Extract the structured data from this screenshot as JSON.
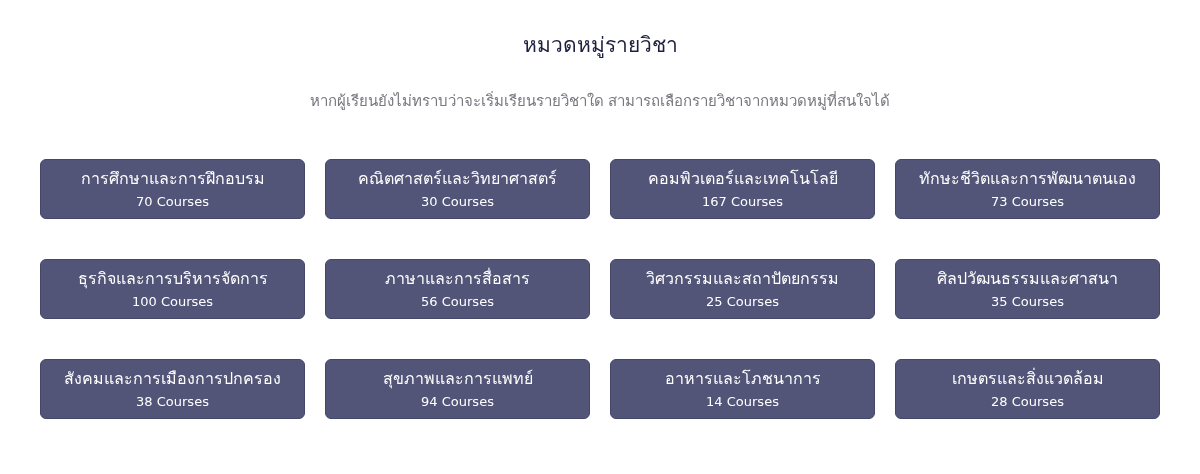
{
  "heading": "หมวดหมู่รายวิชา",
  "subtitle": "หากผู้เรียนยังไม่ทราบว่าจะเริ่มเรียนรายวิชาใด สามารถเลือกรายวิชาจากหมวดหมู่ที่สนใจได้",
  "categories": [
    {
      "name": "การศึกษาและการฝึกอบรม",
      "count": "70 Courses"
    },
    {
      "name": "คณิตศาสตร์และวิทยาศาสตร์",
      "count": "30 Courses"
    },
    {
      "name": "คอมพิวเตอร์และเทคโนโลยี",
      "count": "167 Courses"
    },
    {
      "name": "ทักษะชีวิตและการพัฒนาตนเอง",
      "count": "73 Courses"
    },
    {
      "name": "ธุรกิจและการบริหารจัดการ",
      "count": "100 Courses"
    },
    {
      "name": "ภาษาและการสื่อสาร",
      "count": "56 Courses"
    },
    {
      "name": "วิศวกรรมและสถาปัตยกรรม",
      "count": "25 Courses"
    },
    {
      "name": "ศิลปวัฒนธรรมและศาสนา",
      "count": "35 Courses"
    },
    {
      "name": "สังคมและการเมืองการปกครอง",
      "count": "38 Courses"
    },
    {
      "name": "สุขภาพและการแพทย์",
      "count": "94 Courses"
    },
    {
      "name": "อาหารและโภชนาการ",
      "count": "14 Courses"
    },
    {
      "name": "เกษตรและสิ่งแวดล้อม",
      "count": "28 Courses"
    }
  ]
}
